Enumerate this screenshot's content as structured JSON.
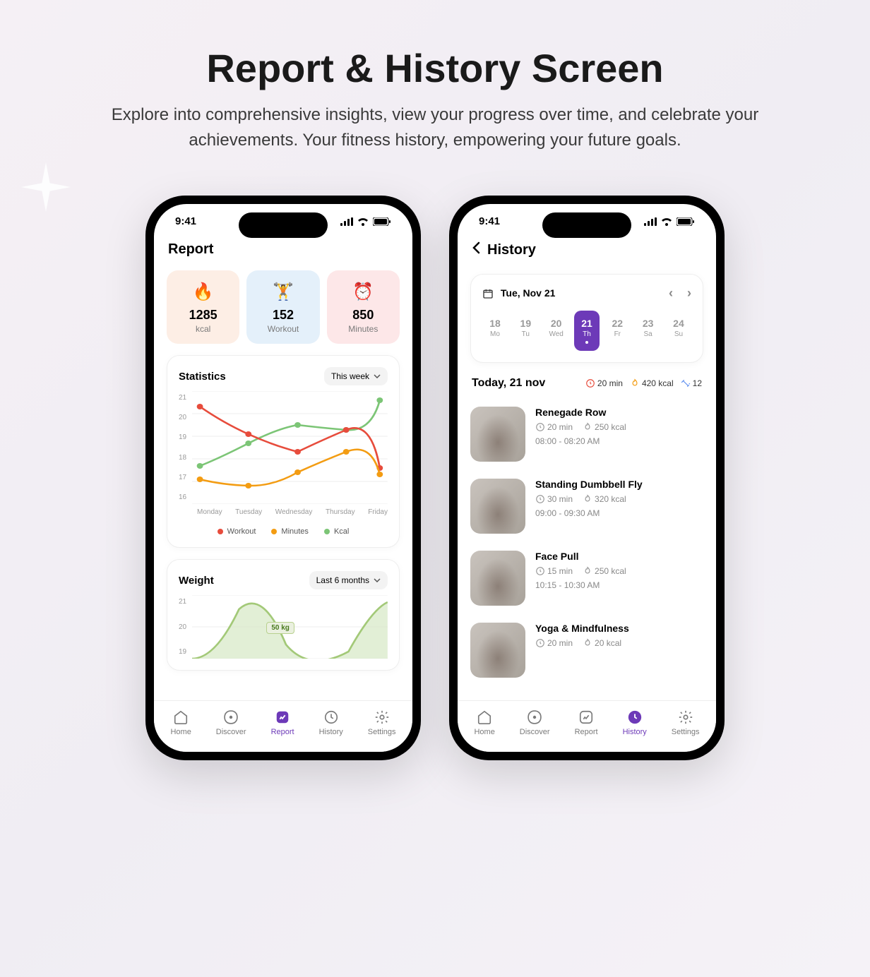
{
  "page": {
    "title": "Report & History Screen",
    "subtitle": "Explore into comprehensive insights, view your progress over time, and celebrate your achievements. Your fitness history, empowering your future goals."
  },
  "status": {
    "time": "9:41"
  },
  "nav": {
    "items": [
      {
        "key": "home",
        "label": "Home"
      },
      {
        "key": "discover",
        "label": "Discover"
      },
      {
        "key": "report",
        "label": "Report"
      },
      {
        "key": "history",
        "label": "History"
      },
      {
        "key": "settings",
        "label": "Settings"
      }
    ]
  },
  "report": {
    "title": "Report",
    "metrics": [
      {
        "icon": "🔥",
        "value": "1285",
        "label": "kcal"
      },
      {
        "icon": "🏋️",
        "value": "152",
        "label": "Workout"
      },
      {
        "icon": "⏰",
        "value": "850",
        "label": "Minutes"
      }
    ],
    "statistics": {
      "title": "Statistics",
      "range": "This week",
      "yTicks": [
        "21",
        "20",
        "19",
        "18",
        "17",
        "16"
      ],
      "xTicks": [
        "Monday",
        "Tuesday",
        "Wednesday",
        "Thursday",
        "Friday"
      ],
      "legend": [
        "Workout",
        "Minutes",
        "Kcal"
      ]
    },
    "chart_data": {
      "statistics_chart": {
        "type": "line",
        "categories": [
          "Monday",
          "Tuesday",
          "Wednesday",
          "Thursday",
          "Friday"
        ],
        "series": [
          {
            "name": "Workout",
            "color": "#e74c3c",
            "values": [
              20.3,
              19.1,
              18.3,
              19.3,
              17.6
            ]
          },
          {
            "name": "Minutes",
            "color": "#f39c12",
            "values": [
              17.1,
              16.8,
              17.4,
              18.3,
              17.3
            ]
          },
          {
            "name": "Kcal",
            "color": "#7cc576",
            "values": [
              17.7,
              18.7,
              19.5,
              19.3,
              20.6
            ]
          }
        ],
        "ylim": [
          16,
          21
        ]
      },
      "weight_chart": {
        "type": "area",
        "title": "Weight",
        "range": "Last 6 months",
        "yTicks": [
          "21",
          "20",
          "19"
        ],
        "annotation": "50 kg",
        "series": [
          {
            "name": "Weight",
            "color": "#a3c978",
            "values": [
              19.0,
              20.8,
              19.1,
              19.2,
              20.6
            ]
          }
        ],
        "ylim": [
          19,
          21
        ]
      }
    },
    "weight": {
      "title": "Weight",
      "range": "Last 6 months",
      "badge": "50 kg",
      "yTicks": [
        "21",
        "20",
        "19"
      ]
    }
  },
  "history": {
    "title": "History",
    "calendar": {
      "label": "Tue, Nov 21",
      "days": [
        {
          "num": "18",
          "wd": "Mo"
        },
        {
          "num": "19",
          "wd": "Tu"
        },
        {
          "num": "20",
          "wd": "Wed"
        },
        {
          "num": "21",
          "wd": "Th",
          "active": true
        },
        {
          "num": "22",
          "wd": "Fr"
        },
        {
          "num": "23",
          "wd": "Sa"
        },
        {
          "num": "24",
          "wd": "Su"
        }
      ]
    },
    "today": {
      "label": "Today, 21 nov",
      "duration": "20 min",
      "calories": "420 kcal",
      "count": "12"
    },
    "workouts": [
      {
        "name": "Renegade Row",
        "duration": "20 min",
        "calories": "250 kcal",
        "time": "08:00 - 08:20 AM"
      },
      {
        "name": "Standing Dumbbell Fly",
        "duration": "30 min",
        "calories": "320 kcal",
        "time": "09:00 - 09:30 AM"
      },
      {
        "name": "Face Pull",
        "duration": "15 min",
        "calories": "250 kcal",
        "time": "10:15 - 10:30 AM"
      },
      {
        "name": "Yoga & Mindfulness",
        "duration": "20 min",
        "calories": "20 kcal",
        "time": ""
      }
    ]
  }
}
